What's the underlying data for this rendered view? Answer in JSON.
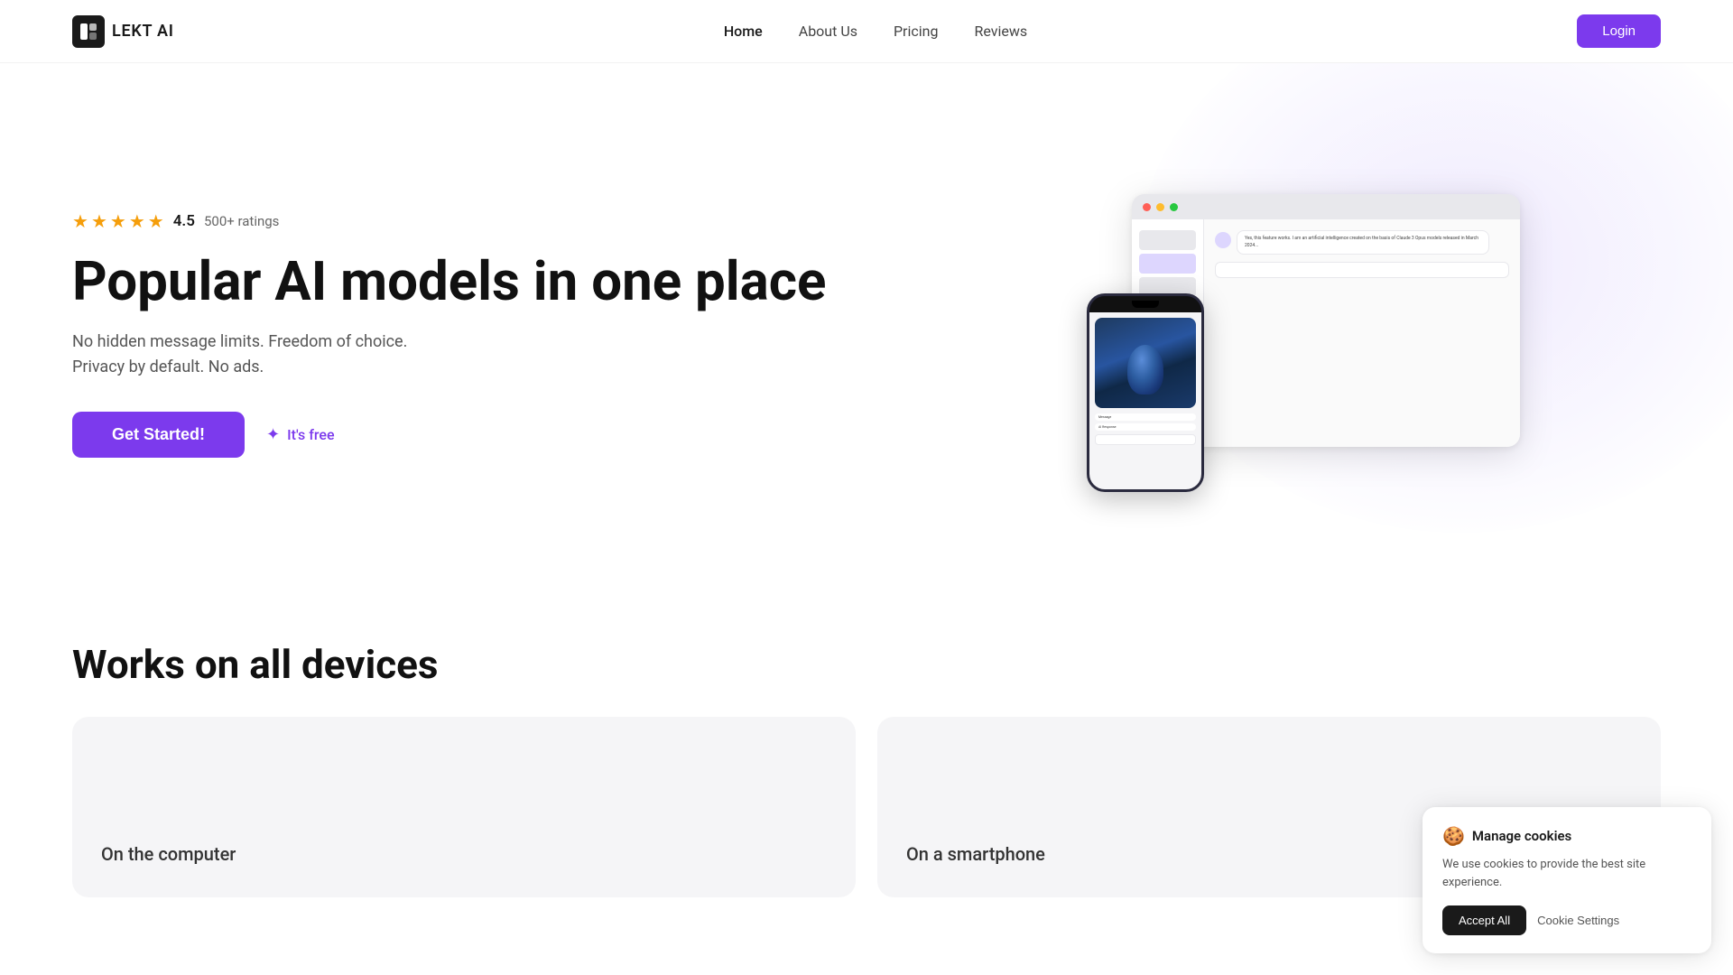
{
  "navbar": {
    "logo_text": "LEKT AI",
    "links": [
      {
        "label": "Home",
        "active": true
      },
      {
        "label": "About Us",
        "active": false
      },
      {
        "label": "Pricing",
        "active": false
      },
      {
        "label": "Reviews",
        "active": false
      }
    ],
    "login_label": "Login"
  },
  "hero": {
    "rating": {
      "score": "4.5",
      "count": "500+ ratings",
      "stars": 5
    },
    "title": "Popular AI models in one place",
    "subtitle": "No hidden message limits. Freedom of choice. Privacy by default. No ads.",
    "cta_label": "Get Started!",
    "free_label": "It's free",
    "sparkle": "✦"
  },
  "works_section": {
    "title": "Works on all devices",
    "cards": [
      {
        "label": "On the computer"
      },
      {
        "label": "On a smartphone"
      }
    ]
  },
  "cookie": {
    "emoji": "🍪",
    "title": "Manage cookies",
    "description": "We use cookies to provide the best site experience.",
    "accept_label": "Accept All",
    "settings_label": "Cookie Settings"
  }
}
